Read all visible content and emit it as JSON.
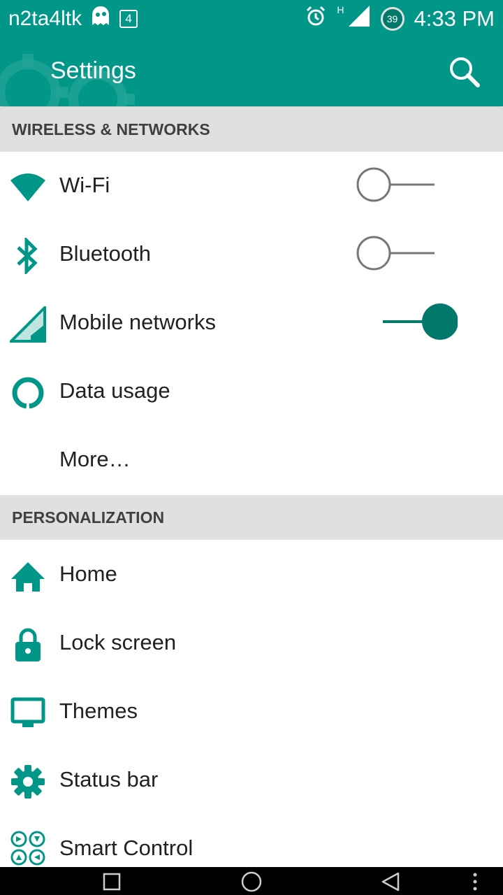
{
  "status_bar": {
    "carrier": "n2ta4ltk",
    "notification_count": "4",
    "network_type": "H",
    "battery_level": "39",
    "time": "4:33 PM"
  },
  "app_bar": {
    "title": "Settings",
    "search_icon": "search-icon"
  },
  "sections": {
    "wireless": {
      "header": "WIRELESS & NETWORKS",
      "items": [
        {
          "label": "Wi-Fi",
          "icon": "wifi-icon",
          "toggle": false
        },
        {
          "label": "Bluetooth",
          "icon": "bluetooth-icon",
          "toggle": false
        },
        {
          "label": "Mobile networks",
          "icon": "signal-icon",
          "toggle": true
        },
        {
          "label": "Data usage",
          "icon": "data-usage-icon"
        },
        {
          "label": "More…"
        }
      ]
    },
    "personalization": {
      "header": "PERSONALIZATION",
      "items": [
        {
          "label": "Home",
          "icon": "home-icon"
        },
        {
          "label": "Lock screen",
          "icon": "lock-icon"
        },
        {
          "label": "Themes",
          "icon": "monitor-icon"
        },
        {
          "label": "Status bar",
          "icon": "gear-icon"
        },
        {
          "label": "Smart Control",
          "icon": "smart-control-icon"
        }
      ]
    }
  },
  "colors": {
    "primary": "#009688",
    "accent": "#00796b",
    "section_bg": "#e0e0e0",
    "text": "#212121"
  }
}
